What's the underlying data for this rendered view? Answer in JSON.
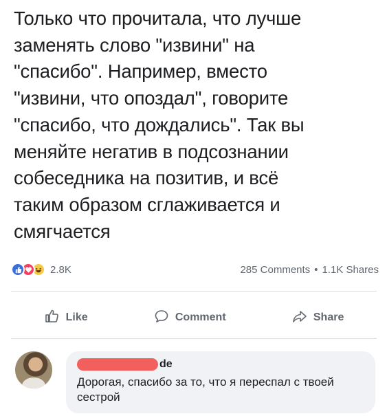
{
  "post": {
    "text": "Только что прочитала, что лучше\nзаменять слово \"извини\" на\n\"спасибо\". Например, вместо\n\"извини, что опоздал\", говорите\n\"спасибо, что дождались\". Так вы\nменяйте негатив в подсознании\nсобеседника на позитив, и всё\nтаким образом сглаживается и\nсмягчается"
  },
  "stats": {
    "reaction_count": "2.8K",
    "comments": "285 Comments",
    "separator": "•",
    "shares": "1.1K Shares",
    "reactions": [
      "like",
      "love",
      "haha"
    ]
  },
  "actions": {
    "like_label": "Like",
    "comment_label": "Comment",
    "share_label": "Share"
  },
  "comment": {
    "author_visible_suffix": "de",
    "text": "Дорогая, спасибо за то, что я переспал с твоей сестрой"
  },
  "colors": {
    "like": "#3b6fd8",
    "love": "#f0425e",
    "haha": "#f7c94a",
    "redaction": "#f25f5c",
    "muted_text": "#606770"
  }
}
